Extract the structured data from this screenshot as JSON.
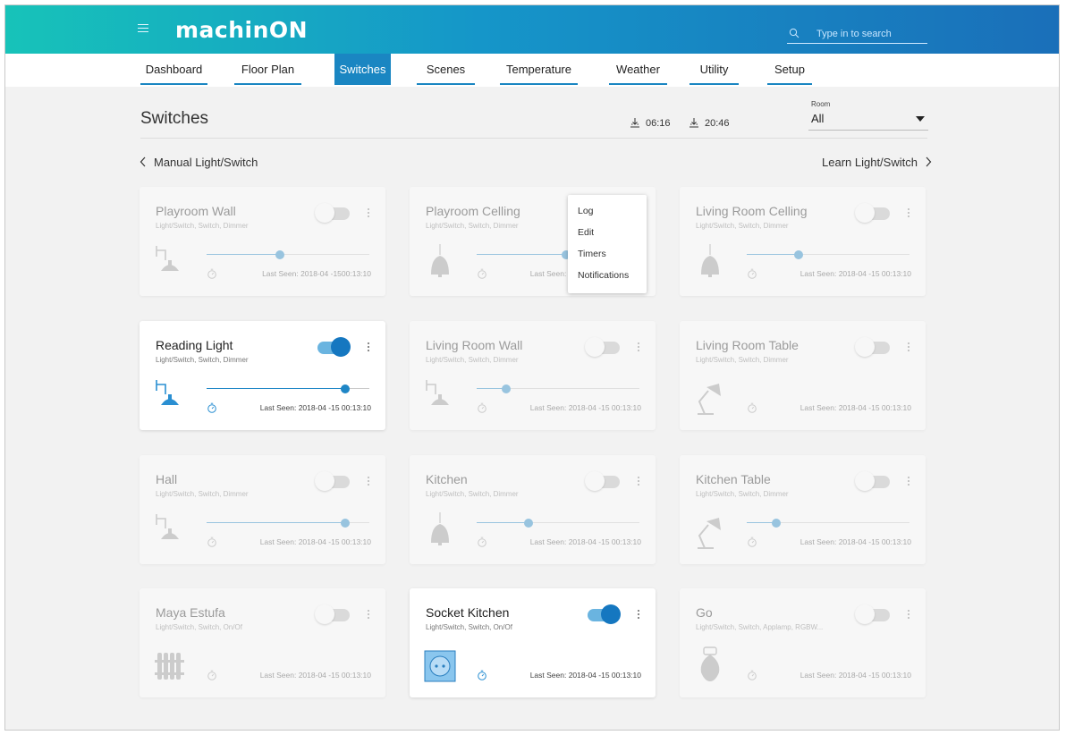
{
  "app": {
    "logo": "machinON"
  },
  "search": {
    "placeholder": "Type in to search"
  },
  "nav": {
    "items": [
      {
        "label": "Dashboard",
        "active": false
      },
      {
        "label": "Floor Plan",
        "active": false
      },
      {
        "label": "Switches",
        "active": true
      },
      {
        "label": "Scenes",
        "active": false
      },
      {
        "label": "Temperature",
        "active": false
      },
      {
        "label": "Weather",
        "active": false
      },
      {
        "label": "Utility",
        "active": false
      },
      {
        "label": "Setup",
        "active": false
      }
    ]
  },
  "page": {
    "title": "Switches",
    "sunrise": "06:16",
    "sunset": "20:46",
    "room_label": "Room",
    "room_value": "All",
    "manual_link": "Manual Light/Switch",
    "learn_link": "Learn Light/Switch"
  },
  "context_menu": {
    "items": [
      "Log",
      "Edit",
      "Timers",
      "Notifications"
    ]
  },
  "colors": {
    "accent": "#1a86c2",
    "toggle_on": "#1577c0",
    "header_start": "#17c3b9",
    "header_end": "#1a6fb9"
  },
  "cards": [
    {
      "name": "Playroom Wall",
      "subtitle": "Light/Switch, Switch, Dimmer",
      "on": false,
      "device": "wall-lamp-icon",
      "dimmer": 0.45,
      "last_seen": "Last Seen: 2018-04 -1500:13:10"
    },
    {
      "name": "Playroom Celling",
      "subtitle": "Light/Switch, Switch, Dimmer",
      "on": false,
      "device": "ceiling-lamp-icon",
      "dimmer": 0.55,
      "last_seen": "Last Seen: 2018-04 -15 00:13:10"
    },
    {
      "name": "Living Room Celling",
      "subtitle": "Light/Switch, Switch, Dimmer",
      "on": false,
      "device": "ceiling-lamp-icon",
      "dimmer": 0.32,
      "last_seen": "Last Seen: 2018-04 -15  00:13:10"
    },
    {
      "name": "Reading Light",
      "subtitle": "Light/Switch, Switch, Dimmer",
      "on": true,
      "device": "wall-lamp-icon",
      "dimmer": 0.85,
      "last_seen": "Last Seen: 2018-04 -15  00:13:10"
    },
    {
      "name": "Living Room Wall",
      "subtitle": "Light/Switch, Switch, Dimmer",
      "on": false,
      "device": "wall-lamp-icon",
      "dimmer": 0.18,
      "last_seen": "Last Seen: 2018-04 -15  00:13:10"
    },
    {
      "name": "Living Room Table",
      "subtitle": "Light/Switch, Switch, Dimmer",
      "on": false,
      "device": "desk-lamp-icon",
      "dimmer": null,
      "last_seen": "Last Seen: 2018-04 -15  00:13:10"
    },
    {
      "name": "Hall",
      "subtitle": "Light/Switch, Switch, Dimmer",
      "on": false,
      "device": "wall-lamp-icon",
      "dimmer": 0.85,
      "last_seen": "Last Seen: 2018-04 -15  00:13:10"
    },
    {
      "name": "Kitchen",
      "subtitle": "Light/Switch, Switch, Dimmer",
      "on": false,
      "device": "ceiling-lamp-icon",
      "dimmer": 0.32,
      "last_seen": "Last Seen: 2018-04 -15  00:13:10"
    },
    {
      "name": "Kitchen Table",
      "subtitle": "Light/Switch, Switch, Dimmer",
      "on": false,
      "device": "desk-lamp-icon",
      "dimmer": 0.18,
      "last_seen": "Last Seen: 2018-04 -15  00:13:10"
    },
    {
      "name": "Maya Estufa",
      "subtitle": "Light/Switch, Switch, On/Of",
      "on": false,
      "device": "radiator-icon",
      "dimmer": null,
      "last_seen": "Last Seen: 2018-04 -15  00:13:10"
    },
    {
      "name": "Socket Kitchen",
      "subtitle": "Light/Switch, Switch, On/Of",
      "on": true,
      "device": "socket-icon",
      "dimmer": null,
      "last_seen": "Last Seen: 2018-04 -15  00:13:10"
    },
    {
      "name": "Go",
      "subtitle": "Light/Switch, Switch, Applamp, RGBW...",
      "on": false,
      "device": "bulb-icon",
      "dimmer": null,
      "last_seen": "Last Seen: 2018-04 -15  00:13:10"
    }
  ]
}
